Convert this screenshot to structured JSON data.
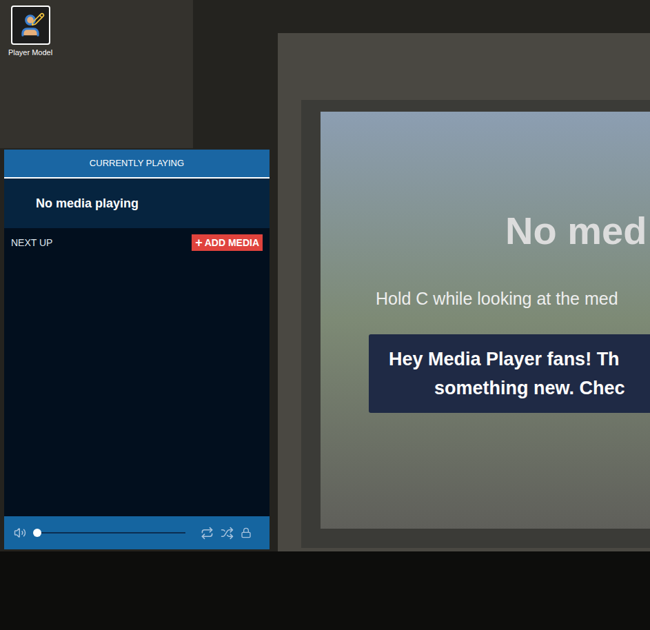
{
  "desktop_icon": {
    "label": "Player Model"
  },
  "media_panel": {
    "header": "CURRENTLY PLAYING",
    "now_playing": "No media playing",
    "queue_title": "NEXT UP",
    "add_button": {
      "icon": "+",
      "label": "ADD MEDIA"
    },
    "queue": [],
    "controls": {
      "seek": {
        "level": 0
      },
      "repeat": {
        "on": false
      },
      "shuffle": {
        "on": false
      },
      "locked": {
        "on": false
      }
    }
  },
  "screen": {
    "title": "No med",
    "hint": "Hold C while looking at the med",
    "notice_lines": [
      "Hey Media Player fans! Th",
      "something new. Chec"
    ]
  }
}
